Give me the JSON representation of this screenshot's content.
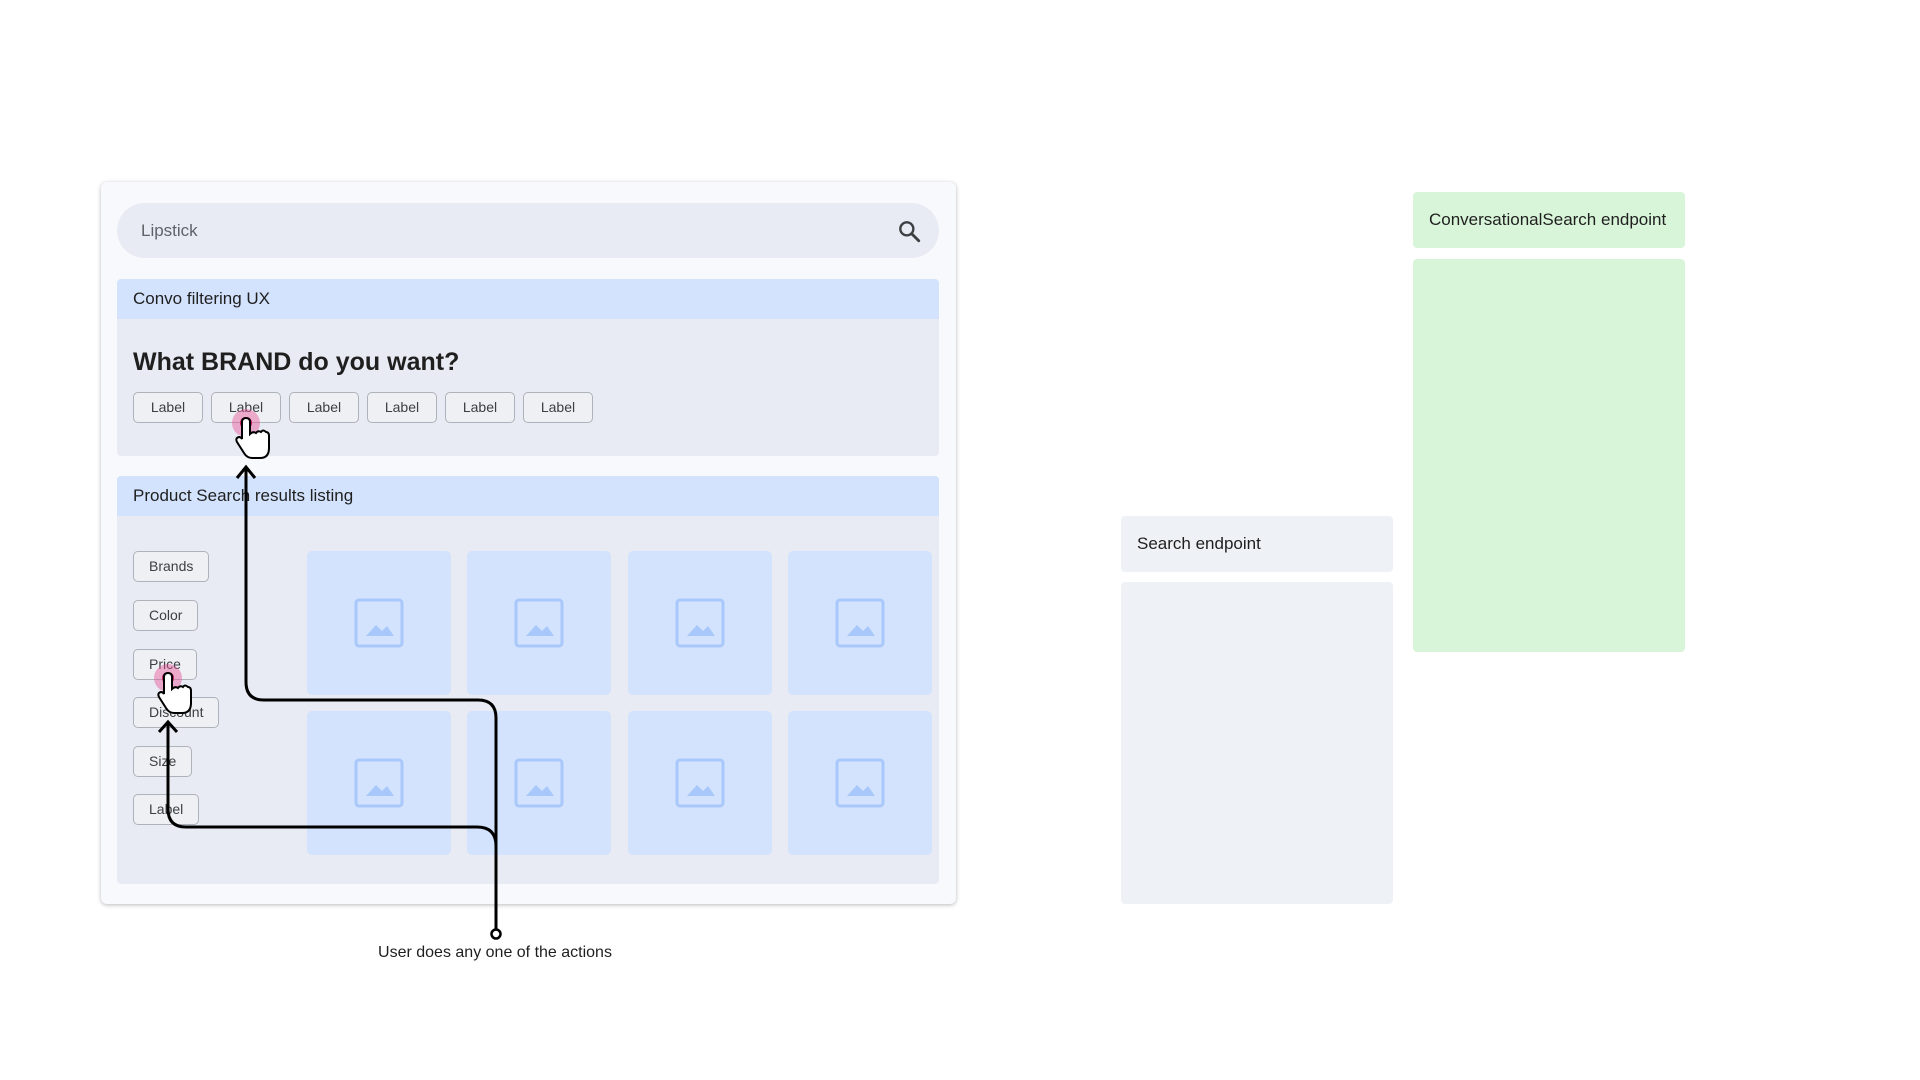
{
  "search": {
    "query": "Lipstick",
    "icon": "search-icon"
  },
  "convo": {
    "header": "Convo filtering UX",
    "question": "What BRAND do you want?",
    "chips": [
      "Label",
      "Label",
      "Label",
      "Label",
      "Label",
      "Label"
    ]
  },
  "results": {
    "header": "Product Search results listing",
    "filters": [
      "Brands",
      "Color",
      "Price",
      "Discount",
      "Size",
      "Label"
    ],
    "tile_icon": "image-placeholder-icon",
    "tile_count": 8
  },
  "endpoints": {
    "search": "Search endpoint",
    "conversational": "ConversationalSearch endpoint"
  },
  "caption": "User does any one of the actions",
  "colors": {
    "panel": "#e8ebf3",
    "header_blue": "#d3e3fd",
    "endpoint_gray": "#eef1f6",
    "endpoint_green": "#d9f5d9",
    "tap_pink": "#e8559a"
  }
}
